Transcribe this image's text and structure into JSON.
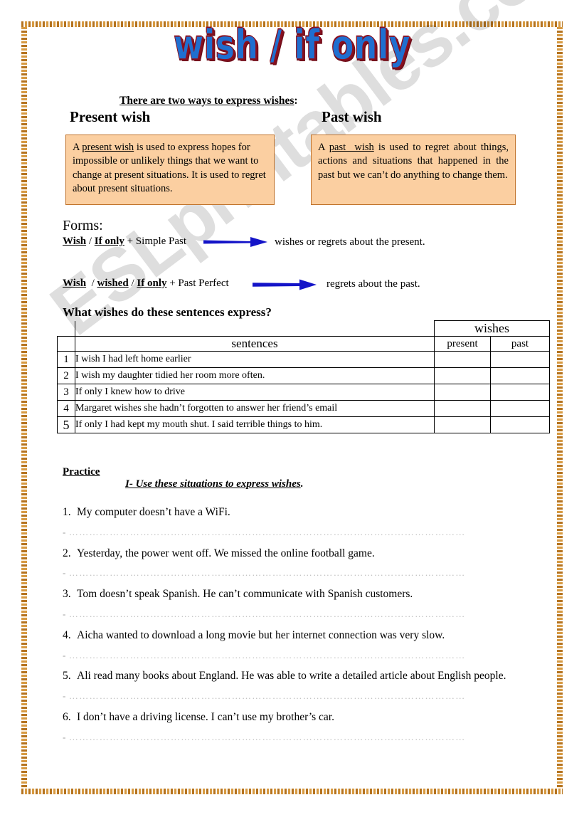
{
  "document": {
    "title": "wish / if only",
    "watermark": "ESLprintables.com",
    "colors": {
      "title_fill": "#1f6fd0",
      "title_outline": "#8b1020",
      "box_fill": "#fbcfa1",
      "box_border": "#c0722a",
      "arrow": "#1414c8",
      "frame": "#b5731f"
    }
  },
  "intro": {
    "heading": "There are two ways to express wishes",
    "heading_suffix": ":",
    "present_heading": "Present wish",
    "past_heading": "Past wish",
    "present_definition_html": "A <u>present wish</u> is used to express hopes for impossible or unlikely things that we want to change at present situations. It is used to regret about present situations.",
    "past_definition_html": "A <u>past&nbsp; wish</u> is used to regret about things, actions and situations that happened in the past but we can’t do anything to change them."
  },
  "forms": {
    "label": "Forms:",
    "rows": [
      {
        "pattern_html": "<b>Wish</b> / <b>If only</b> + Simple Past",
        "result": "wishes or regrets about the present."
      },
      {
        "pattern_html": "<b>Wish</b>&nbsp; / <b>wished</b> / <b>If only</b> + Past Perfect",
        "result": "regrets about the past."
      }
    ]
  },
  "exercise": {
    "question": "What wishes do these sentences express?",
    "table": {
      "group_header": "wishes",
      "col_sentences": "sentences",
      "col_present": "present",
      "col_past": "past",
      "rows": [
        {
          "num": "1",
          "sentence": "I wish I had left home earlier",
          "present": "",
          "past": ""
        },
        {
          "num": "2",
          "sentence": "I wish my daughter tidied her room more often.",
          "present": "",
          "past": ""
        },
        {
          "num": "3",
          "sentence": "If only I knew how to drive",
          "present": "",
          "past": ""
        },
        {
          "num": "4",
          "sentence": "Margaret wishes she hadn’t forgotten to answer her friend’s email",
          "present": "",
          "past": ""
        },
        {
          "num": "5",
          "sentence": "If only I had kept my mouth shut.  I said terrible things to him.",
          "present": "",
          "past": ""
        }
      ]
    }
  },
  "practice": {
    "title": "Practice",
    "instruction": "I- Use these situations to express wishes",
    "instruction_suffix": ".",
    "items": [
      {
        "num": "1.",
        "text": "My computer doesn’t have a WiFi."
      },
      {
        "num": "2.",
        "text": "Yesterday, the power went off. We missed the online football game."
      },
      {
        "num": "3.",
        "text": "Tom doesn’t speak Spanish. He can’t communicate with Spanish customers."
      },
      {
        "num": "4.",
        "text": "Aicha wanted to download a long movie but her internet connection was very slow."
      },
      {
        "num": "5.",
        "text": "Ali read many books about England. He was able to write a detailed article about English people."
      },
      {
        "num": "6.",
        "text": "I don’t have a driving license. I can’t use my brother’s car."
      }
    ],
    "answer_dash": "-",
    "answer_dots": "………………………………………………………………………………………………………"
  }
}
